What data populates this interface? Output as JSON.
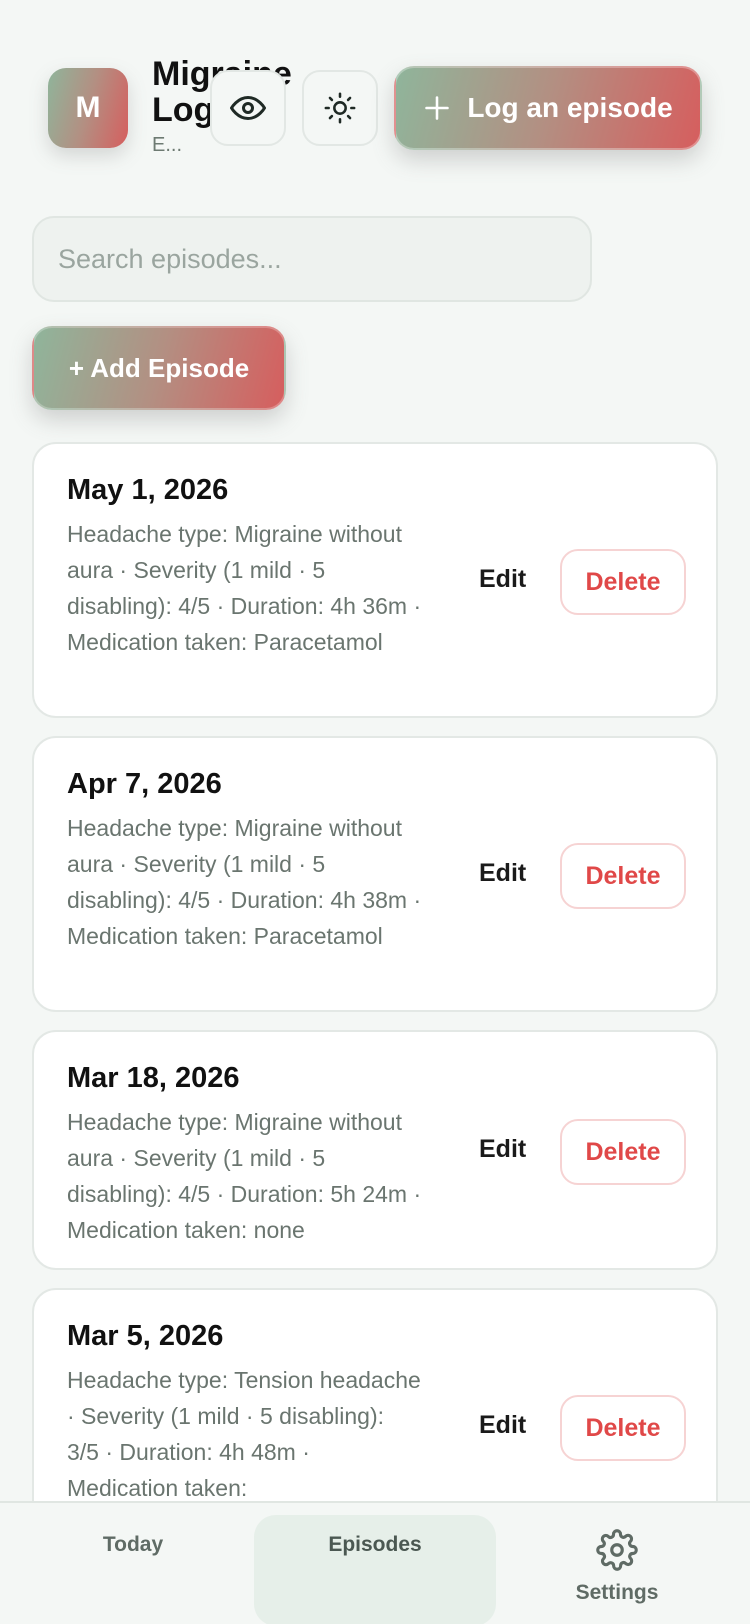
{
  "header": {
    "avatar_letter": "M",
    "app_title": "Migraine Log",
    "app_subtitle": "E...",
    "log_button_label": "Log an episode",
    "icons": {
      "visibility": "eye-icon",
      "theme": "sun-icon",
      "add": "plus-icon"
    }
  },
  "search": {
    "placeholder": "Search episodes...",
    "value": ""
  },
  "add_button_label": "+ Add Episode",
  "episodes": [
    {
      "date": "May 1, 2026",
      "description": "Headache type: Migraine without aura · Severity (1 mild · 5 disabling): 4/5 · Duration: 4h 36m · Medication taken: Paracetamol",
      "edit_label": "Edit",
      "delete_label": "Delete"
    },
    {
      "date": "Apr 7, 2026",
      "description": "Headache type: Migraine without aura · Severity (1 mild · 5 disabling): 4/5 · Duration: 4h 38m · Medication taken: Paracetamol",
      "edit_label": "Edit",
      "delete_label": "Delete"
    },
    {
      "date": "Mar 18, 2026",
      "description": "Headache type: Migraine without aura · Severity (1 mild · 5 disabling): 4/5 · Duration: 5h 24m · Medication taken: none",
      "edit_label": "Edit",
      "delete_label": "Delete"
    },
    {
      "date": "Mar 5, 2026",
      "description": "Headache type: Tension headache · Severity (1 mild · 5 disabling): 3/5 · Duration: 4h 48m · Medication taken:",
      "edit_label": "Edit",
      "delete_label": "Delete"
    }
  ],
  "nav": {
    "today": "Today",
    "episodes": "Episodes",
    "settings": "Settings",
    "active": "Episodes"
  },
  "colors": {
    "accent_green": "#8fb59b",
    "accent_red": "#d65e5e",
    "delete_red": "#e04848",
    "background": "#f4f7f5"
  }
}
